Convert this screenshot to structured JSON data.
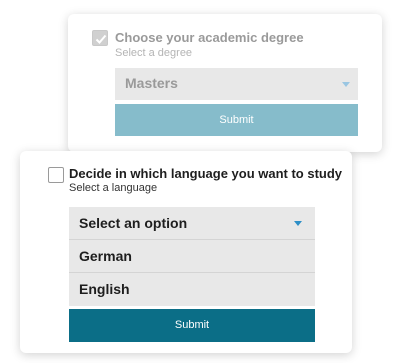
{
  "degree_question": {
    "title": "Choose your academic degree",
    "subtitle": "Select a degree",
    "selected_value": "Masters",
    "submit_label": "Submit",
    "checked": true
  },
  "language_question": {
    "title": "Decide in which language you want to study",
    "subtitle": "Select a language",
    "select_placeholder": "Select an option",
    "options": [
      "German",
      "English"
    ],
    "submit_label": "Submit",
    "checked": false
  },
  "colors": {
    "accent": "#0b6e87",
    "accent_disabled": "#86bccb",
    "caret": "#2d8fc7"
  },
  "icons": [
    "check-icon",
    "caret-down-icon"
  ]
}
